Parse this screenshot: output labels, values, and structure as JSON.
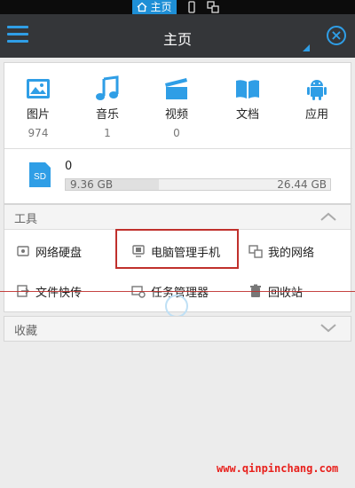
{
  "status_bar": {
    "home_tab_label": "主页",
    "home_icon": "house-icon",
    "phone_icon": "phone-icon",
    "devices_icon": "devices-icon"
  },
  "titlebar": {
    "title": "主页",
    "menu_icon": "hamburger-icon",
    "close_icon": "close-circle-icon",
    "accent": "#2f9ee6"
  },
  "categories": [
    {
      "label": "图片",
      "count": "974",
      "icon": "image-icon"
    },
    {
      "label": "音乐",
      "count": "1",
      "icon": "music-icon"
    },
    {
      "label": "视频",
      "count": "0",
      "icon": "video-icon"
    },
    {
      "label": "文档",
      "count": "",
      "icon": "book-icon"
    },
    {
      "label": "应用",
      "count": "",
      "icon": "android-icon"
    }
  ],
  "storage": {
    "icon_label": "SD",
    "count": "0",
    "used": "9.36 GB",
    "total": "26.44 GB",
    "used_fraction": 0.354
  },
  "tools": {
    "title": "工具",
    "items": [
      {
        "label": "网络硬盘",
        "icon": "cloud-disk-icon"
      },
      {
        "label": "电脑管理手机",
        "icon": "pc-manage-icon"
      },
      {
        "label": "我的网络",
        "icon": "network-icon"
      },
      {
        "label": "文件快传",
        "icon": "file-transfer-icon"
      },
      {
        "label": "任务管理器",
        "icon": "task-manager-icon"
      },
      {
        "label": "回收站",
        "icon": "trash-icon"
      }
    ]
  },
  "favorites": {
    "title": "收藏"
  },
  "watermark": "www.qinpinchang.com",
  "colors": {
    "highlight": "#c0302c",
    "titlebar_bg": "#343639",
    "status_active": "#1e8fd6"
  }
}
